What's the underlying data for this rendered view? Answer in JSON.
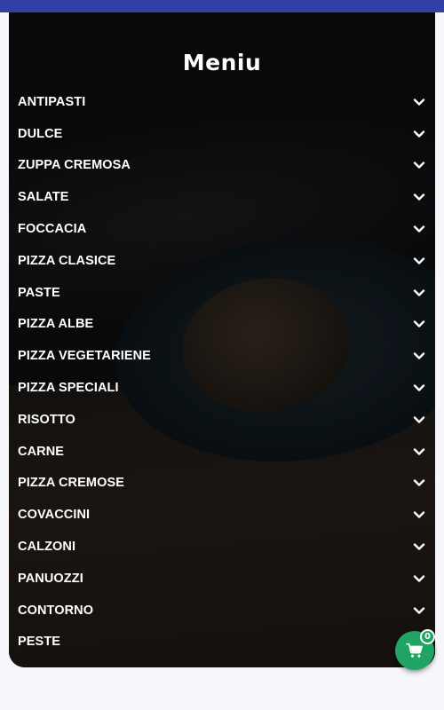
{
  "header": {
    "bar_color": "#2f3fa3"
  },
  "menu": {
    "title": "Meniu",
    "categories": [
      {
        "label": "ANTIPASTI"
      },
      {
        "label": "DULCE"
      },
      {
        "label": "ZUPPA CREMOSA"
      },
      {
        "label": "SALATE"
      },
      {
        "label": "FOCCACIA"
      },
      {
        "label": "PIZZA CLASICE"
      },
      {
        "label": "PASTE"
      },
      {
        "label": "PIZZA ALBE"
      },
      {
        "label": "PIZZA VEGETARIENE"
      },
      {
        "label": "PIZZA SPECIALI"
      },
      {
        "label": "RISOTTO"
      },
      {
        "label": "CARNE"
      },
      {
        "label": "PIZZA CREMOSE"
      },
      {
        "label": "COVACCINI"
      },
      {
        "label": "CALZONI"
      },
      {
        "label": "PANUOZZI"
      },
      {
        "label": "CONTORNO"
      },
      {
        "label": "PESTE"
      }
    ],
    "expand_icon": "chevron-down-icon",
    "background_image": "seafood-pasta-photo"
  },
  "cart": {
    "icon": "shopping-cart-icon",
    "count": "0",
    "color": "#1fa463"
  }
}
